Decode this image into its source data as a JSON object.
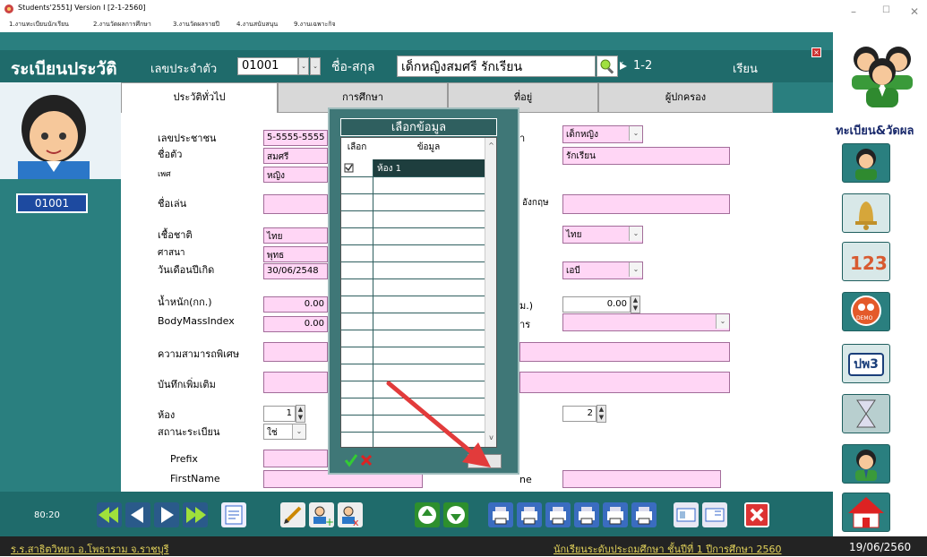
{
  "window": {
    "title": "Students'2551J Version I [2-1-2560]",
    "menus": [
      "1.งานทะเบียนนักเรียน",
      "2.งานวัดผลการศึกษา",
      "3.งานวัดผลรายปี",
      "4.งานสนับสนุน",
      "9.งานเฉพาะกิจ"
    ],
    "controls": {
      "minimize": "–",
      "maximize": "☐",
      "close": "✕"
    }
  },
  "header": {
    "title": "ระเบียนประวัติ",
    "id_label": "เลขประจำตัว",
    "id_value": "01001",
    "name_label": "ชื่อ-สกุล",
    "name_value": "เด็กหญิงสมศรี  รักเรียน",
    "class_value": "1-2",
    "study_label": "เรียน"
  },
  "avatar": {
    "id_badge": "01001"
  },
  "tabs": [
    "ประวัติทั่วไป",
    "การศึกษา",
    "ที่อยู่",
    "ผู้ปกครอง"
  ],
  "form": {
    "national_id_label": "เลขประชาชน",
    "national_id": "5-5555-5555",
    "first_name_label": "ชื่อตัว",
    "first_name": "สมศรี",
    "gender_label": "เพศ",
    "gender": "หญิง",
    "nickname_label": "ชื่อเล่น",
    "nickname": "",
    "ethnicity_label": "เชื้อชาติ",
    "ethnicity": "ไทย",
    "religion_label": "ศาสนา",
    "religion": "พุทธ",
    "birthdate_label": "วันเดือนปีเกิด",
    "birthdate": "30/06/2548",
    "weight_label": "น้ำหนัก(กก.)",
    "weight": "0.00",
    "bmi_label": "BodyMassIndex",
    "bmi": "0.00",
    "special_label": "ความสามารถพิเศษ",
    "special": "",
    "notes_label": "บันทึกเพิ่มเติม",
    "notes": "",
    "room_label": "ห้อง",
    "room": "1",
    "status_label": "สถานะระเบียน",
    "status": "ใช่",
    "prefix_label": "Prefix",
    "prefix": "",
    "firstname_en_label": "FirstName",
    "firstname_en": "",
    "title_frag": "า",
    "title_value": "เด็กหญิง",
    "surname_value": "รักเรียน",
    "english_frag": "อังกฤษ",
    "nationality_value": "ไทย",
    "blood_value": "เอบี",
    "height_frag": "ม.)",
    "height": "0.00",
    "disability_frag": "าร",
    "right_number": "2",
    "lastname_frag": "ne"
  },
  "popup": {
    "title": "เลือกข้อมูล",
    "col_select": "เลือก",
    "col_data": "ข้อมูล",
    "rows": [
      {
        "checked": true,
        "value": "ห้อง 1"
      }
    ]
  },
  "toolbar": {
    "clock": "80:20"
  },
  "statusbar": {
    "school": "ร.ร.สาธิตวิทยา  อ.โพธาราม  จ.ราชบุรี",
    "level": "นักเรียนระดับประถมศึกษา  ชั้นปีที่ 1  ปีการศึกษา 2560",
    "date": "19/06/2560"
  },
  "sidepanel": {
    "title": "ทะเบียน&วัดผล",
    "pw_label": "ปพ3",
    "demo_label": "DEMO",
    "numbers_label": "123"
  },
  "colors": {
    "teal": "#2a7f7f",
    "pink_field": "#ffd6f5",
    "status_text": "#e2d25a"
  }
}
